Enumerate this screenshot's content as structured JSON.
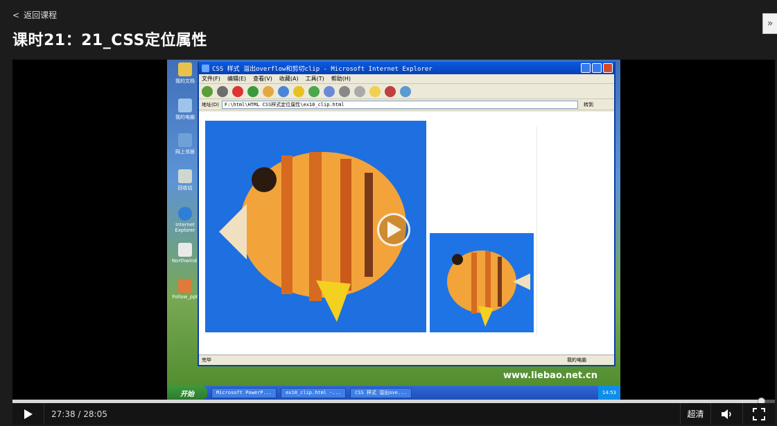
{
  "header": {
    "back_label": "返回课程",
    "lesson_title": "课时21：21_CSS定位属性"
  },
  "video": {
    "screen": {
      "window_title": "CSS 样式 溢出overflow和剪切clip - Microsoft Internet Explorer",
      "menu": [
        "文件(F)",
        "编辑(E)",
        "查看(V)",
        "收藏(A)",
        "工具(T)",
        "帮助(H)"
      ],
      "address_label": "地址(D)",
      "address_value": "F:\\html\\HTML CSS样式定位属性\\ex10_clip.html",
      "go_label": "转到",
      "status_left": "完毕",
      "status_right": "我的电脑",
      "start_label": "开始",
      "tasks": [
        "Microsoft PowerP...",
        "ex10_clip.html -...",
        "CSS 样式 溢出ove..."
      ],
      "clock": "14:53",
      "watermark": "www.liebao.net.cn",
      "desktop_icons": [
        "我的文档",
        "我的电脑",
        "网上邻居",
        "回收站",
        "Internet Explorer",
        "Northwind.",
        "Follow_ppt"
      ]
    },
    "colors": {
      "accent": "#d8d8d8",
      "background": "#1c1c1c"
    }
  },
  "player": {
    "current_time": "27:38",
    "separator": " / ",
    "duration": "28:05",
    "progress_fraction": 0.983,
    "quality_label": "超清"
  }
}
